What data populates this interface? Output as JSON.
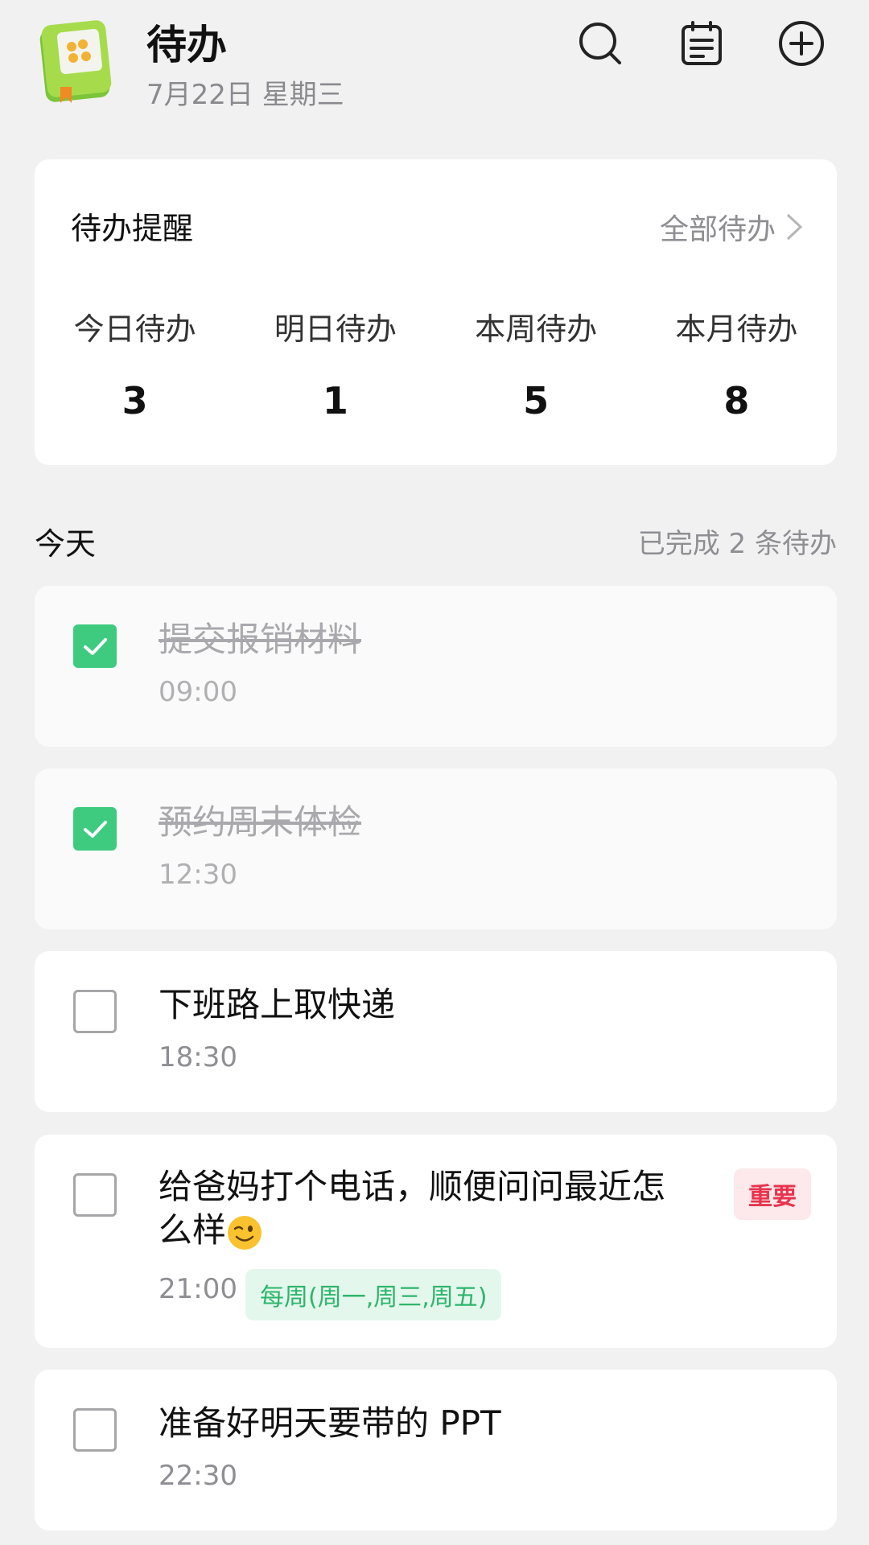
{
  "header": {
    "title": "待办",
    "date": "7月22日 星期三",
    "icons": [
      "notebook-app-icon",
      "search-icon",
      "calendar-note-icon",
      "add-circle-icon"
    ]
  },
  "summary": {
    "title": "待办提醒",
    "all_link": "全部待办",
    "stats": [
      {
        "label": "今日待办",
        "value": "3"
      },
      {
        "label": "明日待办",
        "value": "1"
      },
      {
        "label": "本周待办",
        "value": "5"
      },
      {
        "label": "本月待办",
        "value": "8"
      }
    ]
  },
  "section": {
    "title": "今天",
    "completed_text": "已完成 2 条待办"
  },
  "tasks": [
    {
      "text": "提交报销材料",
      "time": "09:00",
      "done": true
    },
    {
      "text": "预约周末体检",
      "time": "12:30",
      "done": true
    },
    {
      "text": "下班路上取快递",
      "time": "18:30",
      "done": false
    },
    {
      "text_line1": "给爸妈打个电话，顺便问问最近怎",
      "text_line2": "么样",
      "emoji": "winking-face-emoji",
      "time": "21:00",
      "done": false,
      "tag": "重要",
      "repeat": "每周(周一,周三,周五)"
    },
    {
      "text": "准备好明天要带的 PPT",
      "time": "22:30",
      "done": false
    }
  ],
  "colors": {
    "background": "#f1f1f2",
    "check_green": "#3ecb80",
    "important_red": "#e8344e",
    "repeat_green": "#2db56b"
  }
}
